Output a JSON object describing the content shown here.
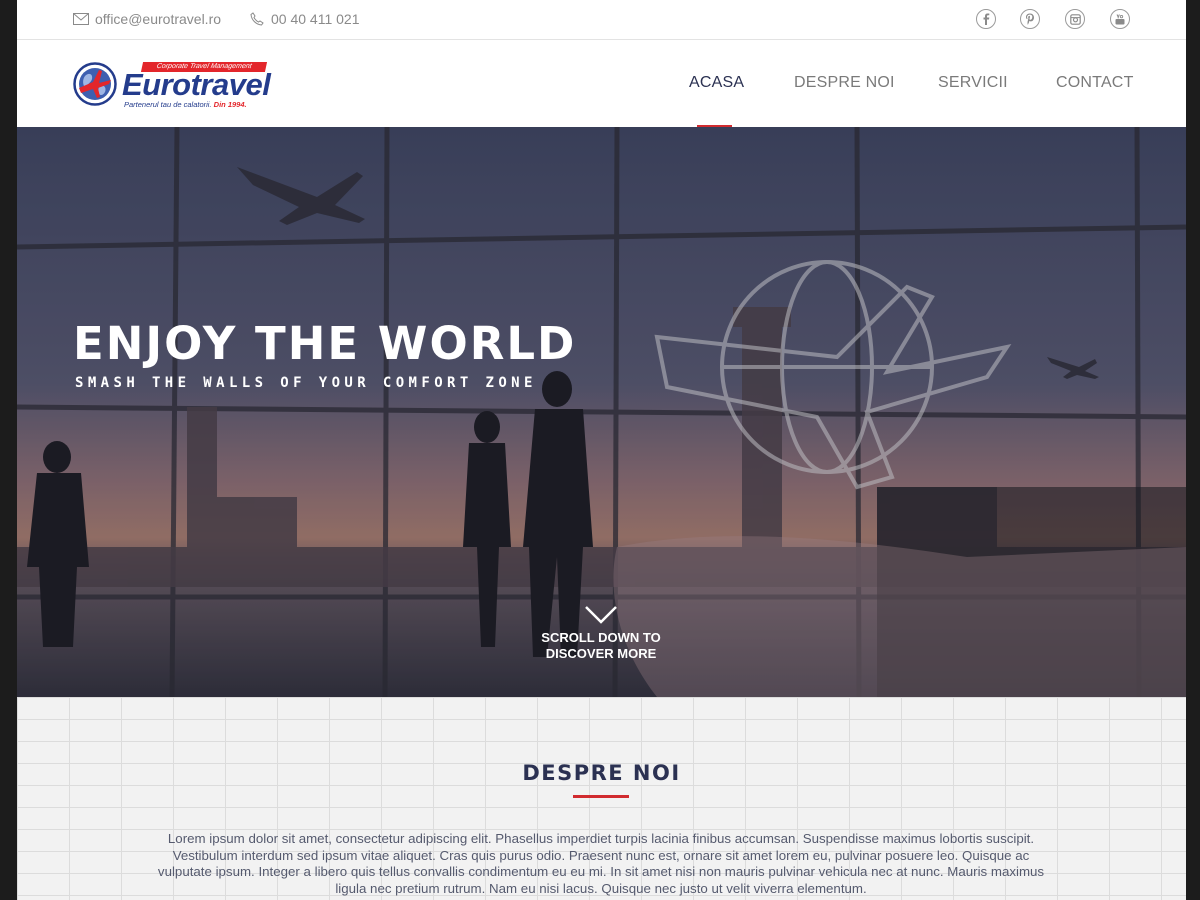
{
  "topbar": {
    "email": "office@eurotravel.ro",
    "phone": "00 40 411 021",
    "social": [
      {
        "icon": "facebook-icon"
      },
      {
        "icon": "pinterest-icon"
      },
      {
        "icon": "instagram-icon"
      },
      {
        "icon": "youtube-icon"
      }
    ]
  },
  "logo": {
    "tagline_top": "Corporate Travel Management",
    "name": "Eurotravel",
    "sub": "Partenerul tau de calatorii.",
    "sub_highlight": "Din 1994."
  },
  "nav": {
    "items": [
      "ACASA",
      "DESPRE NOI",
      "SERVICII",
      "CONTACT"
    ],
    "active": "ACASA"
  },
  "hero": {
    "title": "ENJOY THE WORLD",
    "subtitle": "SMASH THE WALLS OF YOUR COMFORT ZONE",
    "scroll_line1": "SCROLL DOWN TO",
    "scroll_line2": "DISCOVER MORE"
  },
  "about": {
    "title": "DESPRE NOI",
    "text": "Lorem ipsum dolor sit amet, consectetur adipiscing elit. Phasellus imperdiet turpis lacinia finibus accumsan. Suspendisse maximus lobortis suscipit. Vestibulum interdum sed ipsum vitae aliquet. Cras quis purus odio. Praesent nunc est, ornare sit amet lorem eu, pulvinar posuere leo. Quisque ac vulputate ipsum. Integer a libero quis tellus convallis condimentum eu eu mi. In sit amet nisi non mauris pulvinar vehicula nec at nunc. Mauris maximus ligula nec pretium rutrum. Nam eu nisi lacus. Quisque nec justo ut velit viverra elementum."
  },
  "colors": {
    "accent_red": "#d12b2f",
    "brand_blue": "#243c8c",
    "nav_active": "#2b3152"
  }
}
